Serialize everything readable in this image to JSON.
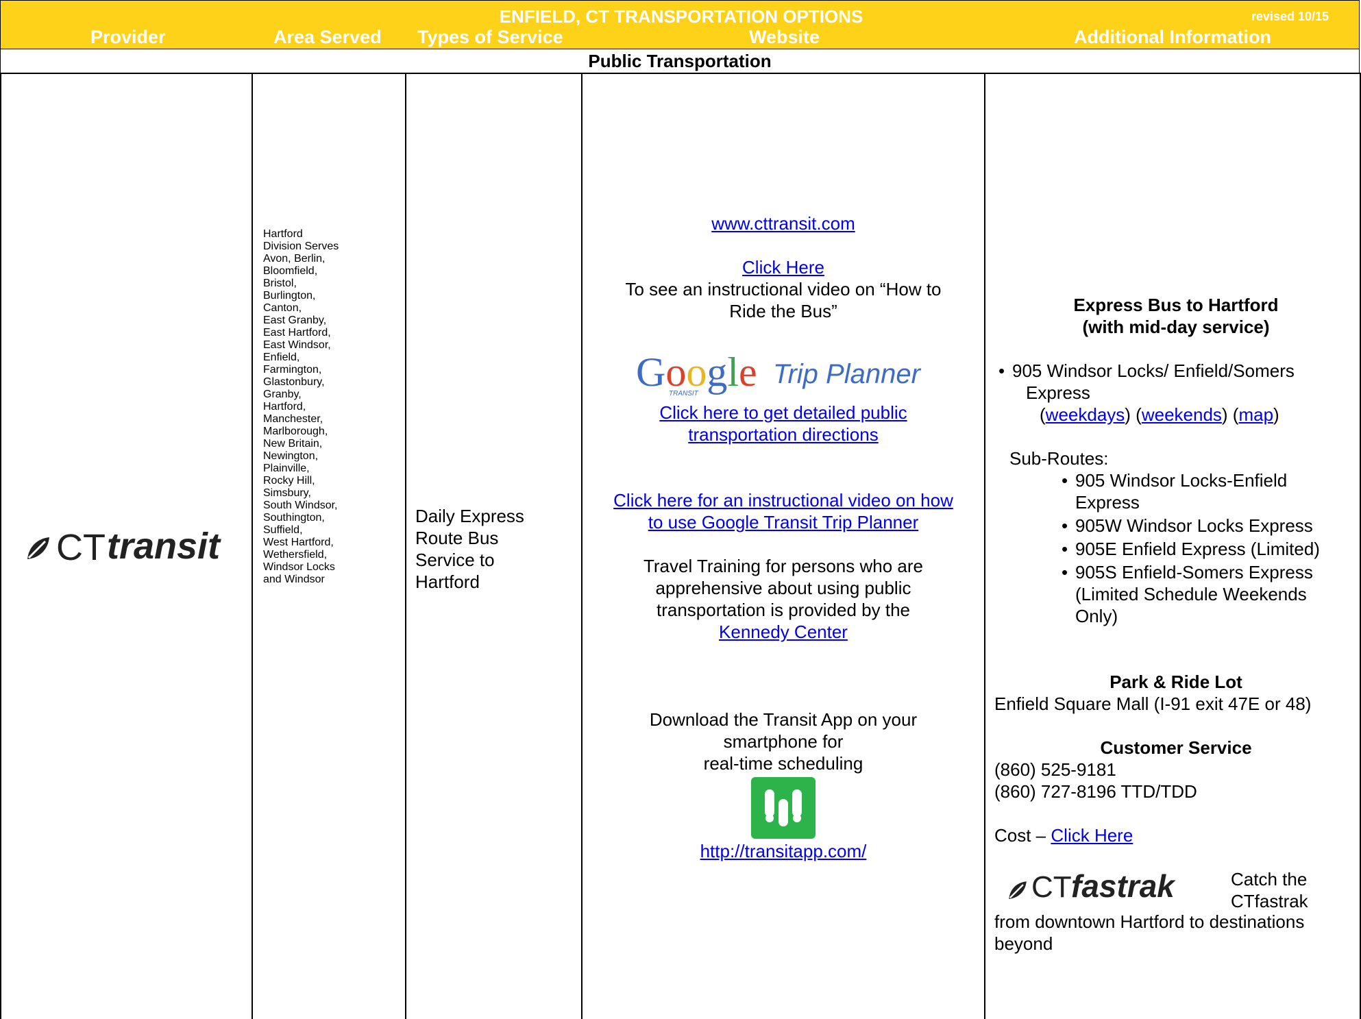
{
  "header": {
    "title": "ENFIELD, CT TRANSPORTATION OPTIONS",
    "revised": "revised 10/15",
    "columns": [
      "Provider",
      "Area Served",
      "Types of Service",
      "Website",
      "Additional Information"
    ]
  },
  "section": {
    "title": "Public Transportation"
  },
  "provider": {
    "logo_text_ct": "CT",
    "logo_text_transit": "transit"
  },
  "area_served": {
    "lines": [
      "Hartford",
      "Division Serves",
      "Avon, Berlin,",
      "Bloomfield,",
      "Bristol,",
      "Burlington,",
      "Canton,",
      "East Granby,",
      "East Hartford,",
      "East Windsor,",
      "Enfield,",
      "Farmington,",
      "Glastonbury,",
      "Granby,",
      "Hartford,",
      "Manchester,",
      "Marlborough,",
      "New Britain,",
      "Newington,",
      "Plainville,",
      "Rocky Hill,",
      "Simsbury,",
      "South Windsor,",
      "Southington,",
      "Suffield,",
      "West Hartford,",
      "Wethersfield,",
      "Windsor Locks",
      "and Windsor"
    ]
  },
  "types_of_service": {
    "lines": [
      "Daily Express",
      "Route Bus",
      "Service to",
      "Hartford"
    ]
  },
  "website": {
    "url": "www.cttransit.com",
    "click_here": "Click Here",
    "video_note_1": "To see an instructional video on “How to",
    "video_note_2": "Ride the Bus”",
    "google_word": "Google",
    "google_transit": "TRANSIT",
    "trip_planner": "Trip Planner",
    "directions_link_1": "Click here to get detailed public",
    "directions_link_2": "transportation directions",
    "planner_video_link_1": "Click here for an instructional video on how",
    "planner_video_link_2": "to use Google Transit Trip Planner",
    "training_1": "Travel Training for persons who are",
    "training_2": "apprehensive about using public",
    "training_3": "transportation is provided by the",
    "kennedy_link": "Kennedy Center",
    "app_1": "Download the Transit App on your",
    "app_2": "smartphone for",
    "app_3": "real-time scheduling",
    "app_url": "http://transitapp.com/"
  },
  "additional": {
    "express_title_1": "Express Bus to Hartford",
    "express_title_2": "(with mid-day service)",
    "route_905_1": "905  Windsor Locks/ Enfield/Somers",
    "route_905_2": "Express",
    "weekdays": "weekdays",
    "weekends": "weekends",
    "map": "map",
    "subroutes_label": "Sub-Routes:",
    "sub_1a": "905 Windsor Locks-Enfield",
    "sub_1b": "Express",
    "sub_2": "905W Windsor Locks Express",
    "sub_3": "905E Enfield Express (Limited)",
    "sub_4a": "905S Enfield-Somers Express",
    "sub_4b": "(Limited Schedule Weekends",
    "sub_4c": "Only)",
    "park_title": "Park & Ride Lot",
    "park_text": "Enfield Square Mall (I-91 exit 47E or 48)",
    "cs_title": "Customer Service",
    "cs_phone_1": "(860) 525-9181",
    "cs_phone_2": "(860) 727-8196 TTD/TDD",
    "cost_label": "Cost –",
    "cost_link": "Click Here",
    "fastrak_ct": "CT",
    "fastrak_word": "fastrak",
    "fastrak_note_1": "Catch the",
    "fastrak_note_2": "CTfastrak",
    "fastrak_note_3": "from downtown Hartford to destinations",
    "fastrak_note_4": "beyond"
  },
  "colors": {
    "header_bg": "#FFD21A",
    "header_text": "#FFFFFF",
    "link": "#0000EE",
    "app_green": "#2CB34A"
  }
}
